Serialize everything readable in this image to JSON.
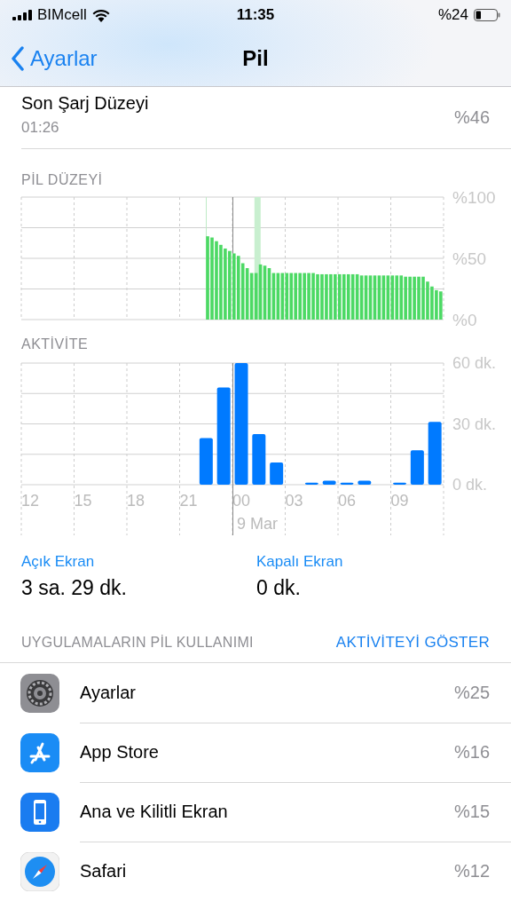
{
  "status_bar": {
    "carrier": "BIMcell",
    "time": "11:35",
    "battery_text": "%24"
  },
  "nav": {
    "back_label": "Ayarlar",
    "title": "Pil"
  },
  "last_charge": {
    "label": "Son Şarj Düzeyi",
    "time": "01:26",
    "value": "%46"
  },
  "battery_chart": {
    "heading": "PİL DÜZEYİ",
    "chart_data": {
      "type": "bar",
      "ylim": [
        0,
        100
      ],
      "yticks": [
        {
          "value": 0,
          "label": "%0"
        },
        {
          "value": 50,
          "label": "%50"
        },
        {
          "value": 100,
          "label": "%100"
        }
      ],
      "categories": [
        null,
        null,
        null,
        null,
        null,
        null,
        null,
        null,
        null,
        null,
        null,
        null,
        null,
        null,
        null,
        null,
        null,
        null,
        null,
        null,
        null,
        null,
        null,
        null,
        null,
        null,
        null,
        null,
        null,
        null,
        null,
        null,
        null,
        null,
        null,
        null,
        null,
        null,
        null,
        null,
        null,
        null,
        null,
        null,
        null,
        null,
        null,
        null,
        null,
        null,
        null,
        null,
        null,
        null
      ],
      "series": [
        {
          "color": "#4cd964",
          "values": [
            68,
            67,
            64,
            61,
            58,
            56,
            54,
            52,
            46,
            42,
            38,
            38,
            45,
            44,
            42,
            38,
            38,
            38,
            38,
            38,
            38,
            38,
            38,
            38,
            38,
            37,
            37,
            37,
            37,
            37,
            37,
            37,
            37,
            37,
            37,
            36,
            36,
            36,
            36,
            36,
            36,
            36,
            36,
            36,
            36,
            35,
            35,
            35,
            35,
            35,
            31,
            27,
            24,
            23
          ]
        }
      ]
    }
  },
  "activity_chart": {
    "heading": "AKTİVİTE",
    "date_label": "9 Mar",
    "chart_data": {
      "type": "bar",
      "ylim": [
        0,
        60
      ],
      "categories": [
        "12",
        null,
        null,
        "15",
        null,
        null,
        "18",
        null,
        null,
        "21",
        null,
        null,
        "00",
        null,
        null,
        "03",
        null,
        null,
        "06",
        null,
        null,
        "09",
        null,
        null
      ],
      "yticks": [
        {
          "value": 0,
          "label": "0 dk."
        },
        {
          "value": 30,
          "label": "30 dk."
        },
        {
          "value": 60,
          "label": "60 dk."
        }
      ],
      "series": [
        {
          "color": "#007aff",
          "values": [
            0,
            0,
            0,
            0,
            0,
            0,
            0,
            0,
            0,
            0,
            23,
            48,
            60,
            25,
            11,
            0,
            1,
            2,
            1,
            2,
            0,
            1,
            17,
            31
          ]
        }
      ]
    }
  },
  "screen_time": [
    {
      "label": "Açık Ekran",
      "value": "3 sa. 29 dk."
    },
    {
      "label": "Kapalı Ekran",
      "value": "0 dk."
    }
  ],
  "usage": {
    "heading": "UYGULAMALARIN PİL KULLANIMI",
    "action": "AKTİVİTEYİ GÖSTER",
    "apps": [
      {
        "kind": "settings",
        "name": "Ayarlar",
        "percent": "%25"
      },
      {
        "kind": "store",
        "name": "App Store",
        "percent": "%16"
      },
      {
        "kind": "phone",
        "name": "Ana ve Kilitli Ekran",
        "percent": "%15"
      },
      {
        "kind": "compass",
        "name": "Safari",
        "percent": "%12"
      }
    ]
  }
}
